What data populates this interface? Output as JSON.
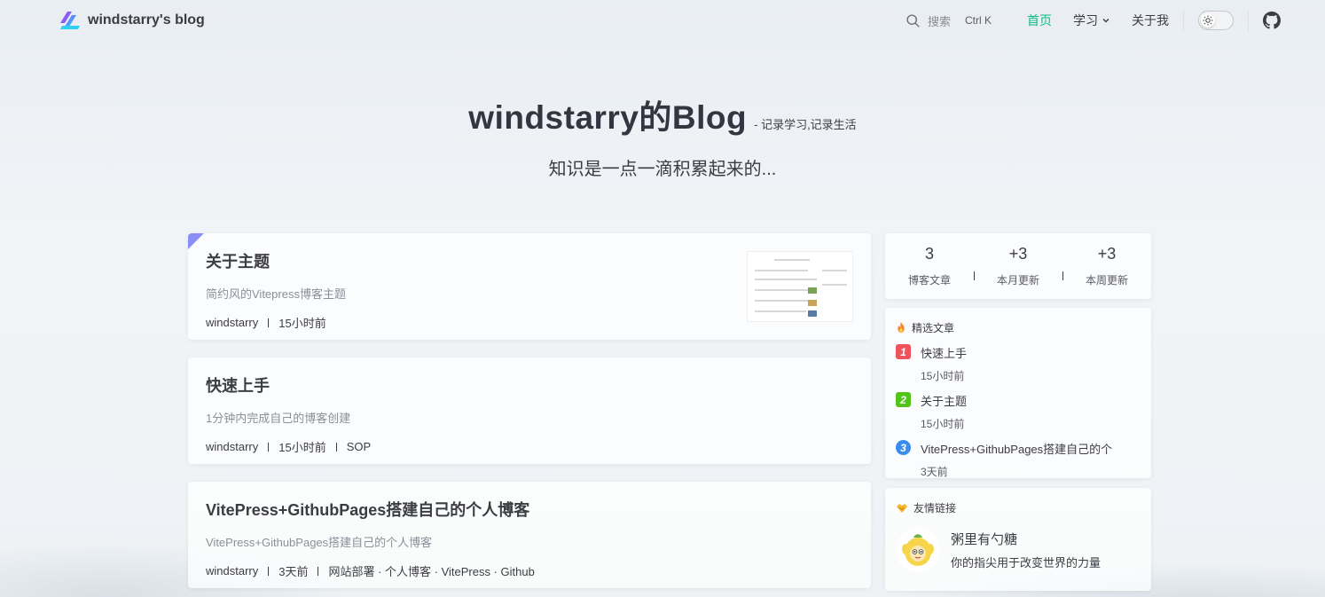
{
  "brand": {
    "title": "windstarry's blog"
  },
  "nav": {
    "search_label": "搜索",
    "search_shortcut": "Ctrl K",
    "links": [
      {
        "label": "首页",
        "active": true
      },
      {
        "label": "学习"
      },
      {
        "label": "关于我"
      }
    ]
  },
  "hero": {
    "title": "windstarry的Blog",
    "tagline": "- 记录学习,记录生活",
    "subtitle": "知识是一点一滴积累起来的..."
  },
  "posts": [
    {
      "title": "关于主题",
      "desc": "简约风的Vitepress博客主题",
      "author": "windstarry",
      "time": "15小时前",
      "tags": "",
      "pinned": true
    },
    {
      "title": "快速上手",
      "desc": "1分钟内完成自己的博客创建",
      "author": "windstarry",
      "time": "15小时前",
      "tags": "SOP"
    },
    {
      "title": "VitePress+GithubPages搭建自己的个人博客",
      "desc": "VitePress+GithubPages搭建自己的个人博客",
      "author": "windstarry",
      "time": "3天前",
      "tags": "网站部署 · 个人博客 · VitePress · Github"
    }
  ],
  "stats": [
    {
      "value": "3",
      "label": "博客文章"
    },
    {
      "value": "+3",
      "label": "本月更新"
    },
    {
      "value": "+3",
      "label": "本周更新"
    }
  ],
  "featured": {
    "heading": "精选文章",
    "items": [
      {
        "rank": "1",
        "title": "快速上手",
        "time": "15小时前",
        "color": "#f0535a"
      },
      {
        "rank": "2",
        "title": "关于主题",
        "time": "15小时前",
        "color": "#52c41a"
      },
      {
        "rank": "3",
        "title": "VitePress+GithubPages搭建自己的个",
        "time": "3天前",
        "color": "#3b8cf0"
      }
    ]
  },
  "friends": {
    "heading": "友情链接",
    "items": [
      {
        "name": "粥里有勺糖",
        "desc": "你的指尖用于改变世界的力量"
      }
    ]
  },
  "colors": {
    "accent": "#10b981",
    "pin": "#8b8ff5"
  }
}
